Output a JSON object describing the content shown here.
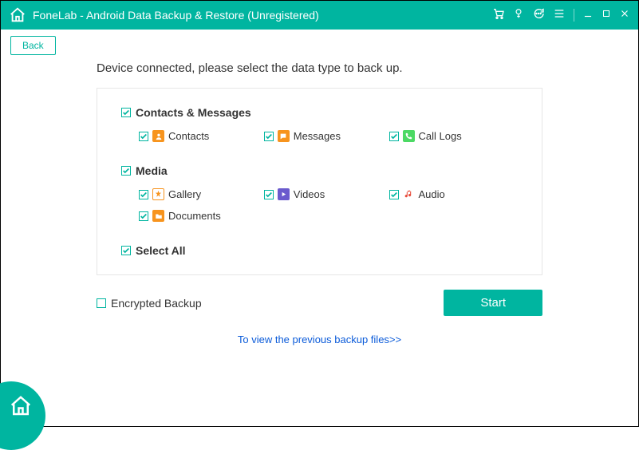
{
  "titlebar": {
    "title": "FoneLab - Android Data Backup & Restore (Unregistered)"
  },
  "back_button": "Back",
  "prompt": "Device connected, please select the data type to back up.",
  "groups": {
    "contacts": {
      "label": "Contacts & Messages"
    },
    "media": {
      "label": "Media"
    },
    "select_all": {
      "label": "Select All"
    }
  },
  "items": {
    "contacts": "Contacts",
    "messages": "Messages",
    "call_logs": "Call Logs",
    "gallery": "Gallery",
    "videos": "Videos",
    "audio": "Audio",
    "documents": "Documents"
  },
  "encrypted": "Encrypted Backup",
  "start": "Start",
  "previous_link": "To view the previous backup files>>"
}
